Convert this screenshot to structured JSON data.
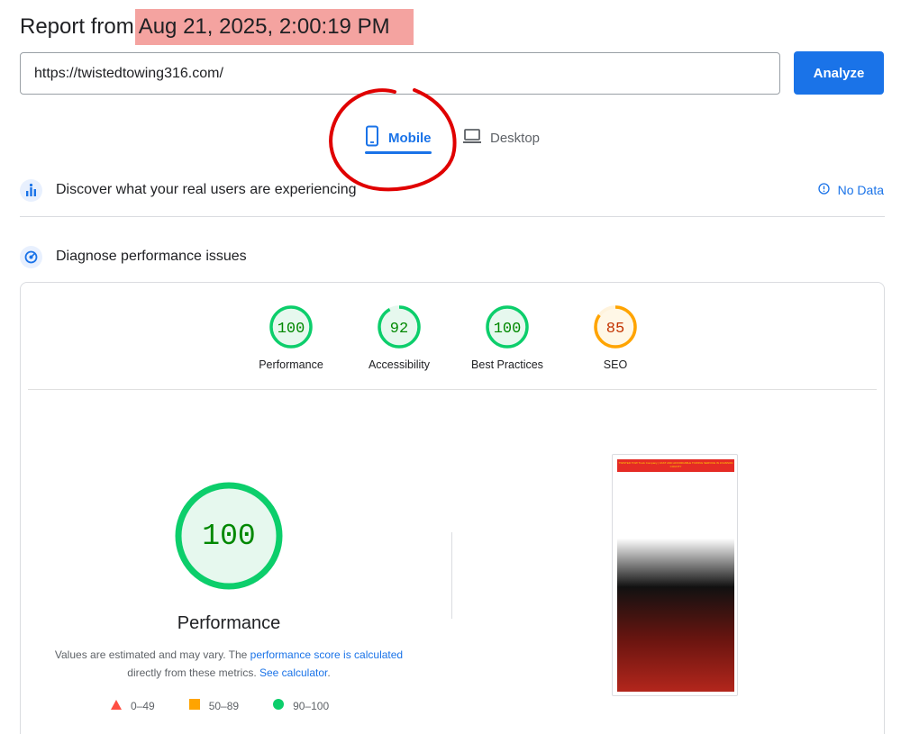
{
  "header": {
    "title_prefix": "Report from",
    "date": "Aug 21, 2025, 2:00:19 PM"
  },
  "url_bar": {
    "value": "https://twistedtowing316.com/",
    "analyze_label": "Analyze"
  },
  "device_tabs": [
    {
      "label": "Mobile",
      "icon": "smartphone-icon",
      "selected": true
    },
    {
      "label": "Desktop",
      "icon": "laptop-icon",
      "selected": false
    }
  ],
  "field_data": {
    "title": "Discover what your real users are experiencing",
    "no_data_label": "No Data"
  },
  "diagnose": {
    "title": "Diagnose performance issues"
  },
  "scores": [
    {
      "label": "Performance",
      "value": "100",
      "color": "#0cce6b",
      "text_color": "#008800"
    },
    {
      "label": "Accessibility",
      "value": "92",
      "color": "#0cce6b",
      "text_color": "#008800"
    },
    {
      "label": "Best Practices",
      "value": "100",
      "color": "#0cce6b",
      "text_color": "#008800"
    },
    {
      "label": "SEO",
      "value": "85",
      "color": "#ffa400",
      "text_color": "#c33300"
    }
  ],
  "performance": {
    "score": "100",
    "label": "Performance",
    "note_pre": "Values are estimated and may vary. The ",
    "note_link1": "performance score is calculated",
    "note_mid": " directly from these metrics. ",
    "note_link2": "See calculator",
    "note_post": "."
  },
  "legend": [
    {
      "shape": "triangle",
      "range": "0–49",
      "color": "#ff4e42"
    },
    {
      "shape": "square",
      "range": "50–89",
      "color": "#ffa400"
    },
    {
      "shape": "circle",
      "range": "90–100",
      "color": "#0cce6b"
    }
  ],
  "thumbnail": {
    "banner_text": "TWISTED TOW Truck Company | FAST AND AFFORDABLE TOWING SERVICE IN JOHNSON COUNTY"
  },
  "colors": {
    "accent": "#1a73e8",
    "pass": "#0cce6b",
    "average": "#ffa400",
    "fail": "#ff4e42",
    "highlight": "#f4a3a0",
    "annotation": "#e00000"
  }
}
